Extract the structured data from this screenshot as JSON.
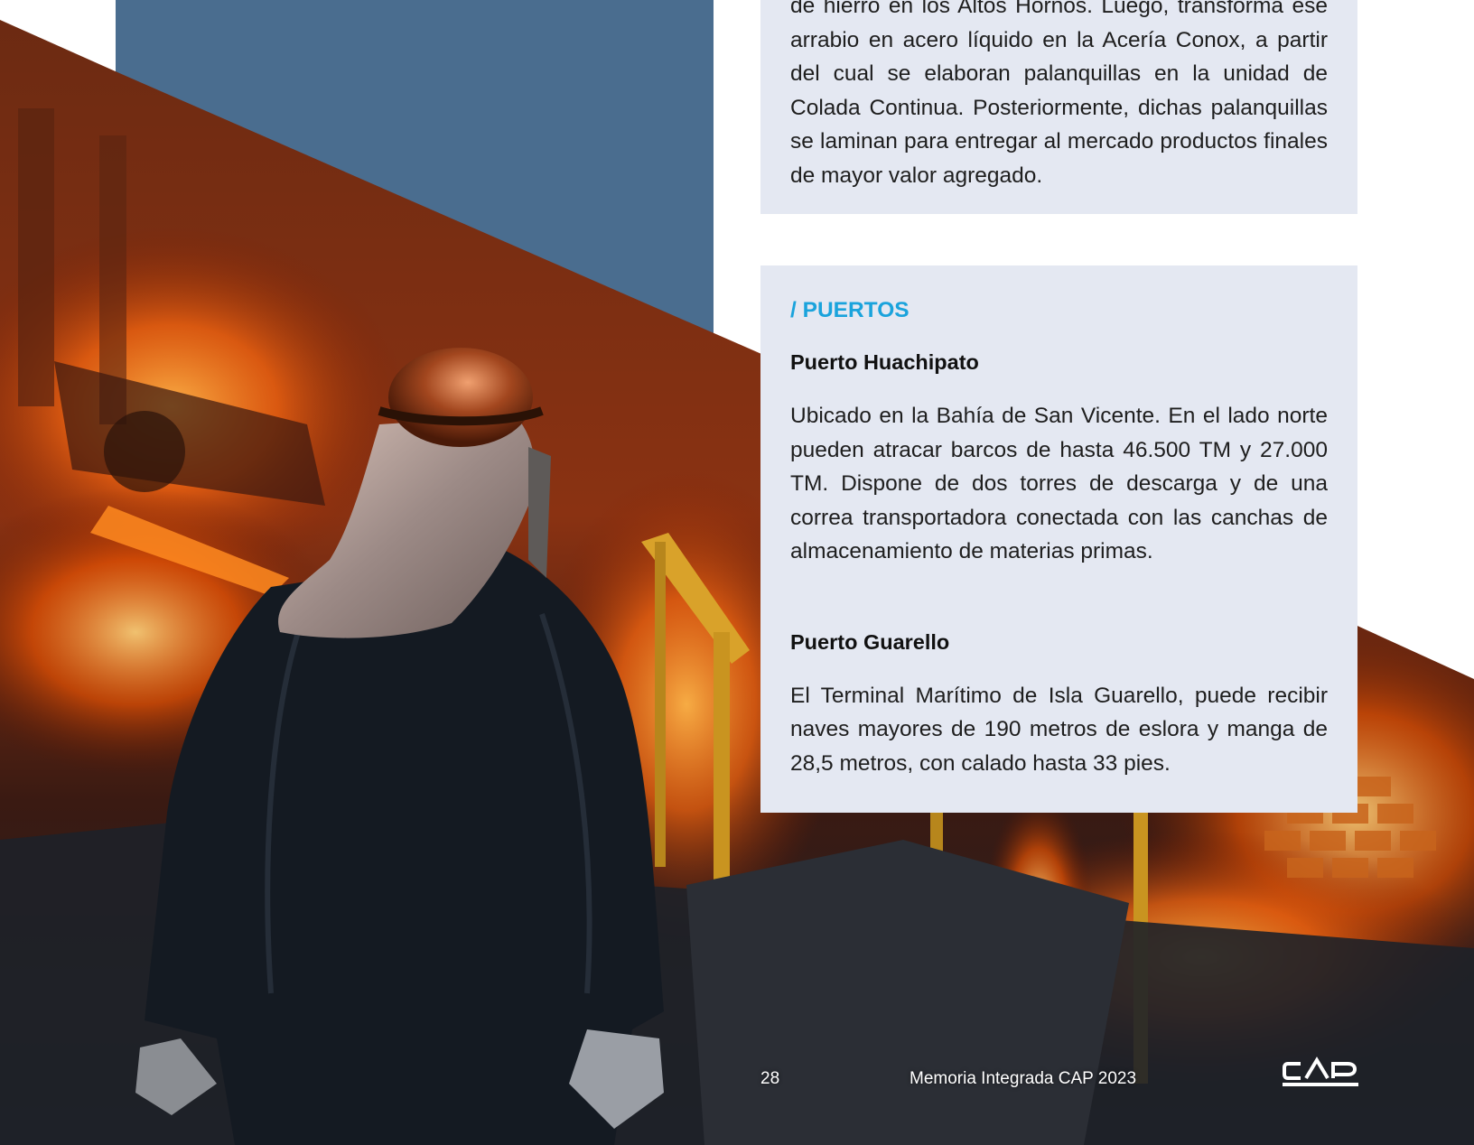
{
  "intro_block": {
    "text": "de hierro en los Altos Hornos. Luego, transforma ese arrabio en acero líquido en la Acería Conox, a partir del cual se elaboran palanquillas en la unidad de Colada Continua. Posteriormente, dichas palanquillas se laminan para entregar al mercado productos finales de mayor valor agregado."
  },
  "puertos": {
    "section_title": "/ PUERTOS",
    "items": [
      {
        "title": "Puerto Huachipato",
        "text": "Ubicado en la Bahía de San Vicente. En el lado norte pueden atracar barcos de hasta 46.500 TM y 27.000 TM. Dispone de dos torres de descarga y de una correa transportadora conectada con las canchas de almacenamiento de materias primas."
      },
      {
        "title": "Puerto Guarello",
        "text": "El Terminal Marítimo de Isla Guarello, puede recibir naves mayores de 190 metros de eslora y manga de 28,5 metros, con calado hasta 33 pies."
      }
    ]
  },
  "footer": {
    "page_number": "28",
    "document_title": "Memoria Integrada CAP 2023",
    "logo_text": "CAP"
  },
  "colors": {
    "panel_blue": "#4a6d8f",
    "card_background": "#e4e8f2",
    "accent_cyan": "#1aa3dc",
    "molten_orange": "#ff6a10"
  },
  "photo": {
    "subject": "steel worker in protective hood and dark suit near molten metal"
  }
}
